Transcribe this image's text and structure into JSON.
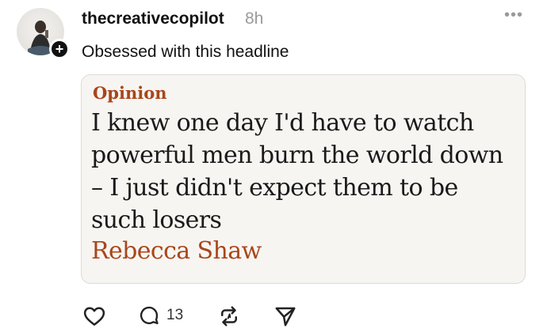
{
  "post": {
    "username": "thecreativecopilot",
    "time": "8h",
    "text": "Obsessed with this headline",
    "more_label": "•••"
  },
  "card": {
    "section": "Opinion",
    "headline": "I knew one day I'd have to watch powerful men burn the world down – I just didn't expect them to be such losers",
    "author": "Rebecca Shaw"
  },
  "actions": {
    "reply_count": "13"
  },
  "icons": {
    "like": "heart-icon",
    "reply": "comment-icon",
    "repost": "repost-icon",
    "share": "send-icon",
    "follow": "plus-icon",
    "more": "more-icon"
  }
}
